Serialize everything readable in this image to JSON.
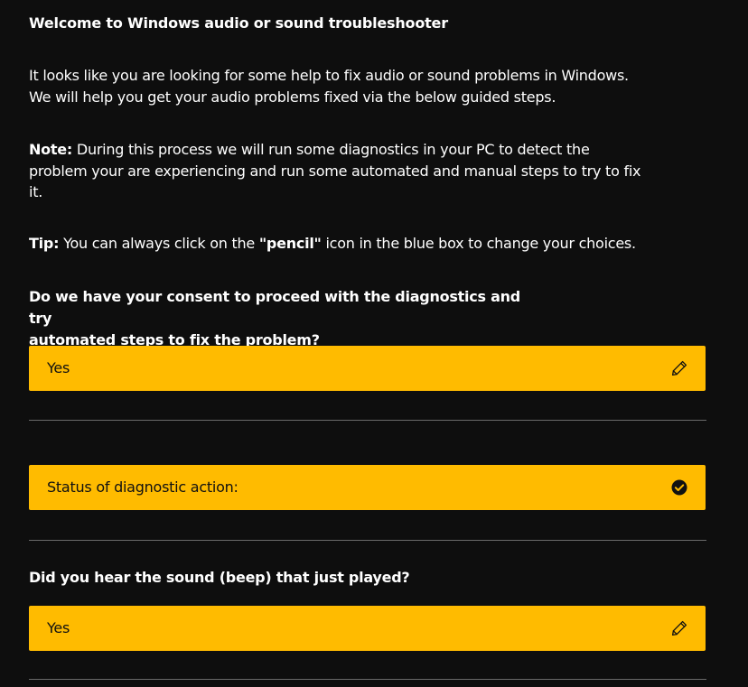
{
  "header": {
    "title": "Welcome to Windows audio or sound troubleshooter"
  },
  "intro": {
    "line1": "It looks like you are looking for some help to fix audio or sound problems in Windows.",
    "line2": "We will help you get your audio problems fixed via the below guided steps."
  },
  "note": {
    "label": "Note:",
    "line1": " During this process we will run some diagnostics in your PC to detect the",
    "line2": "problem your are experiencing and run some automated  and manual steps to try to fix",
    "line3": "it."
  },
  "tip": {
    "label": "Tip:",
    "text_before": " You can always click on the ",
    "highlight": "\"pencil\"",
    "text_after": " icon in the blue box to change your choices."
  },
  "consent": {
    "question_line1": "Do we have your consent to proceed with the diagnostics and try",
    "question_line2": "automated steps to fix the problem?",
    "answer": "Yes",
    "edit_icon": "pencil-icon"
  },
  "status": {
    "label": "Status of diagnostic action:",
    "icon": "check-circle-icon"
  },
  "sound": {
    "question": "Did you hear the sound (beep) that just played?",
    "answer": "Yes",
    "edit_icon": "pencil-icon"
  },
  "colors": {
    "background": "#0e0e0e",
    "answer_box": "#ffbb00",
    "text": "#ffffff",
    "divider": "#6a6a6a"
  }
}
